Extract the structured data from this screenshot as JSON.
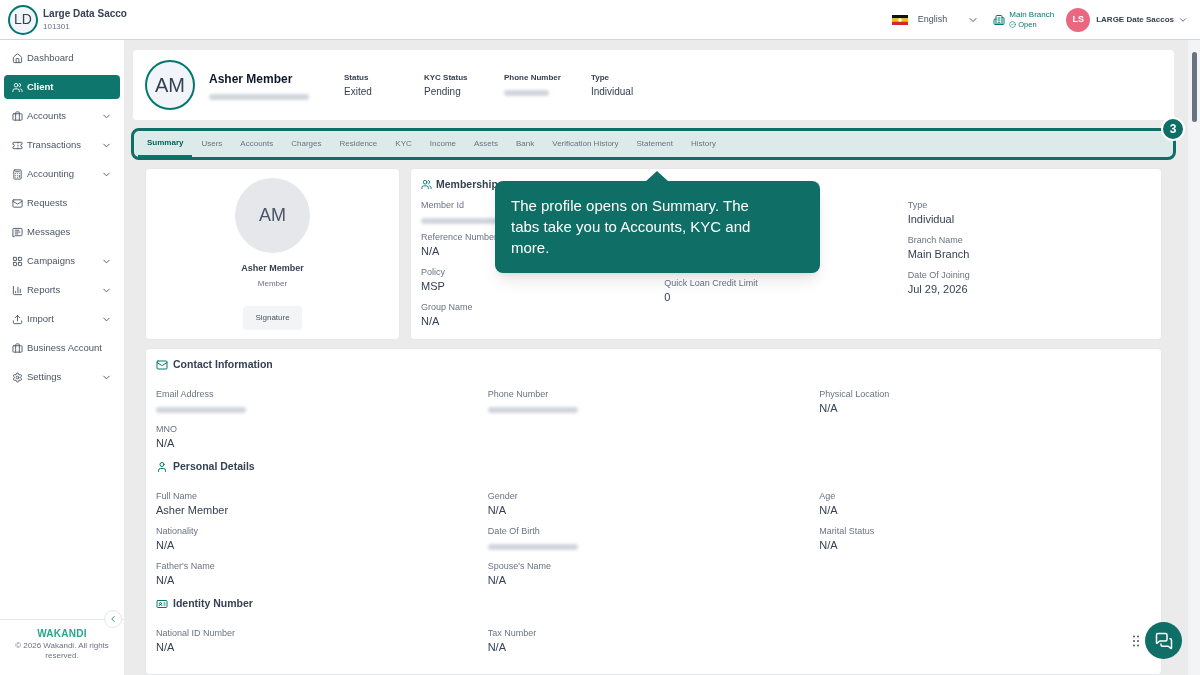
{
  "org": {
    "initials": "LD",
    "name": "Large Data Sacco",
    "code": "101301"
  },
  "topbar": {
    "language": "English",
    "branch": {
      "name": "Main Branch",
      "status": "Open"
    },
    "user": {
      "initials": "LS",
      "name": "LARGE Date Saccos"
    }
  },
  "sidebar": {
    "items": [
      {
        "label": "Dashboard",
        "expandable": false,
        "selected": false
      },
      {
        "label": "Client",
        "expandable": false,
        "selected": true
      },
      {
        "label": "Accounts",
        "expandable": true,
        "selected": false
      },
      {
        "label": "Transactions",
        "expandable": true,
        "selected": false
      },
      {
        "label": "Accounting",
        "expandable": true,
        "selected": false
      },
      {
        "label": "Requests",
        "expandable": false,
        "selected": false
      },
      {
        "label": "Messages",
        "expandable": false,
        "selected": false
      },
      {
        "label": "Campaigns",
        "expandable": true,
        "selected": false
      },
      {
        "label": "Reports",
        "expandable": true,
        "selected": false
      },
      {
        "label": "Import",
        "expandable": true,
        "selected": false
      },
      {
        "label": "Business Account",
        "expandable": false,
        "selected": false
      },
      {
        "label": "Settings",
        "expandable": true,
        "selected": false
      }
    ],
    "logo": "WAKANDI",
    "copyright": "© 2026 Wakandi. All rights reserved."
  },
  "profile_header": {
    "initials": "AM",
    "name": "Asher Member",
    "stats": [
      {
        "label": "Status",
        "value": "Exited"
      },
      {
        "label": "KYC Status",
        "value": "Pending"
      },
      {
        "label": "Phone Number"
      },
      {
        "label": "Type",
        "value": "Individual"
      }
    ]
  },
  "tabs": [
    {
      "label": "Summary",
      "selected": true
    },
    {
      "label": "Users",
      "selected": false
    },
    {
      "label": "Accounts",
      "selected": false
    },
    {
      "label": "Charges",
      "selected": false
    },
    {
      "label": "Residence",
      "selected": false
    },
    {
      "label": "KYC",
      "selected": false
    },
    {
      "label": "Income",
      "selected": false
    },
    {
      "label": "Assets",
      "selected": false
    },
    {
      "label": "Bank",
      "selected": false
    },
    {
      "label": "Verification History",
      "selected": false
    },
    {
      "label": "Statement",
      "selected": false
    },
    {
      "label": "History",
      "selected": false
    }
  ],
  "tour": {
    "step": "3",
    "text": "The profile opens on Summary. The tabs take you to Accounts, KYC and more."
  },
  "profile_card": {
    "initials": "AM",
    "name": "Asher Member",
    "role": "Member",
    "button": "Signature"
  },
  "membership": {
    "title": "Membership",
    "columns": [
      [
        {
          "label": "Member Id"
        },
        {
          "label": "Reference Number",
          "value": "N/A"
        },
        {
          "label": "Policy",
          "value": "MSP"
        },
        {
          "label": "Group Name",
          "value": "N/A"
        }
      ],
      [
        {
          "label": "Quick Loan Credit Limit",
          "value": "0"
        }
      ],
      [
        {
          "label": "Type",
          "value": "Individual"
        },
        {
          "label": "Branch Name",
          "value": "Main Branch"
        },
        {
          "label": "Date Of Joining",
          "value": "Jul 29, 2026"
        }
      ]
    ]
  },
  "sections": [
    {
      "title": "Contact Information",
      "fields": [
        {
          "label": "Email Address"
        },
        {
          "label": "Phone Number"
        },
        {
          "label": "Physical Location",
          "value": "N/A"
        },
        {
          "label": "MNO",
          "value": "N/A"
        }
      ]
    },
    {
      "title": "Personal Details",
      "fields": [
        {
          "label": "Full Name",
          "value": "Asher Member"
        },
        {
          "label": "Gender",
          "value": "N/A"
        },
        {
          "label": "Age",
          "value": "N/A"
        },
        {
          "label": "Nationality",
          "value": "N/A"
        },
        {
          "label": "Date Of Birth"
        },
        {
          "label": "Marital Status",
          "value": "N/A"
        },
        {
          "label": "Father's Name",
          "value": "N/A"
        },
        {
          "label": "Spouse's Name",
          "value": "N/A"
        }
      ]
    },
    {
      "title": "Identity Number",
      "fields": [
        {
          "label": "National ID Number",
          "value": "N/A"
        },
        {
          "label": "Tax Number",
          "value": "N/A"
        }
      ]
    }
  ]
}
